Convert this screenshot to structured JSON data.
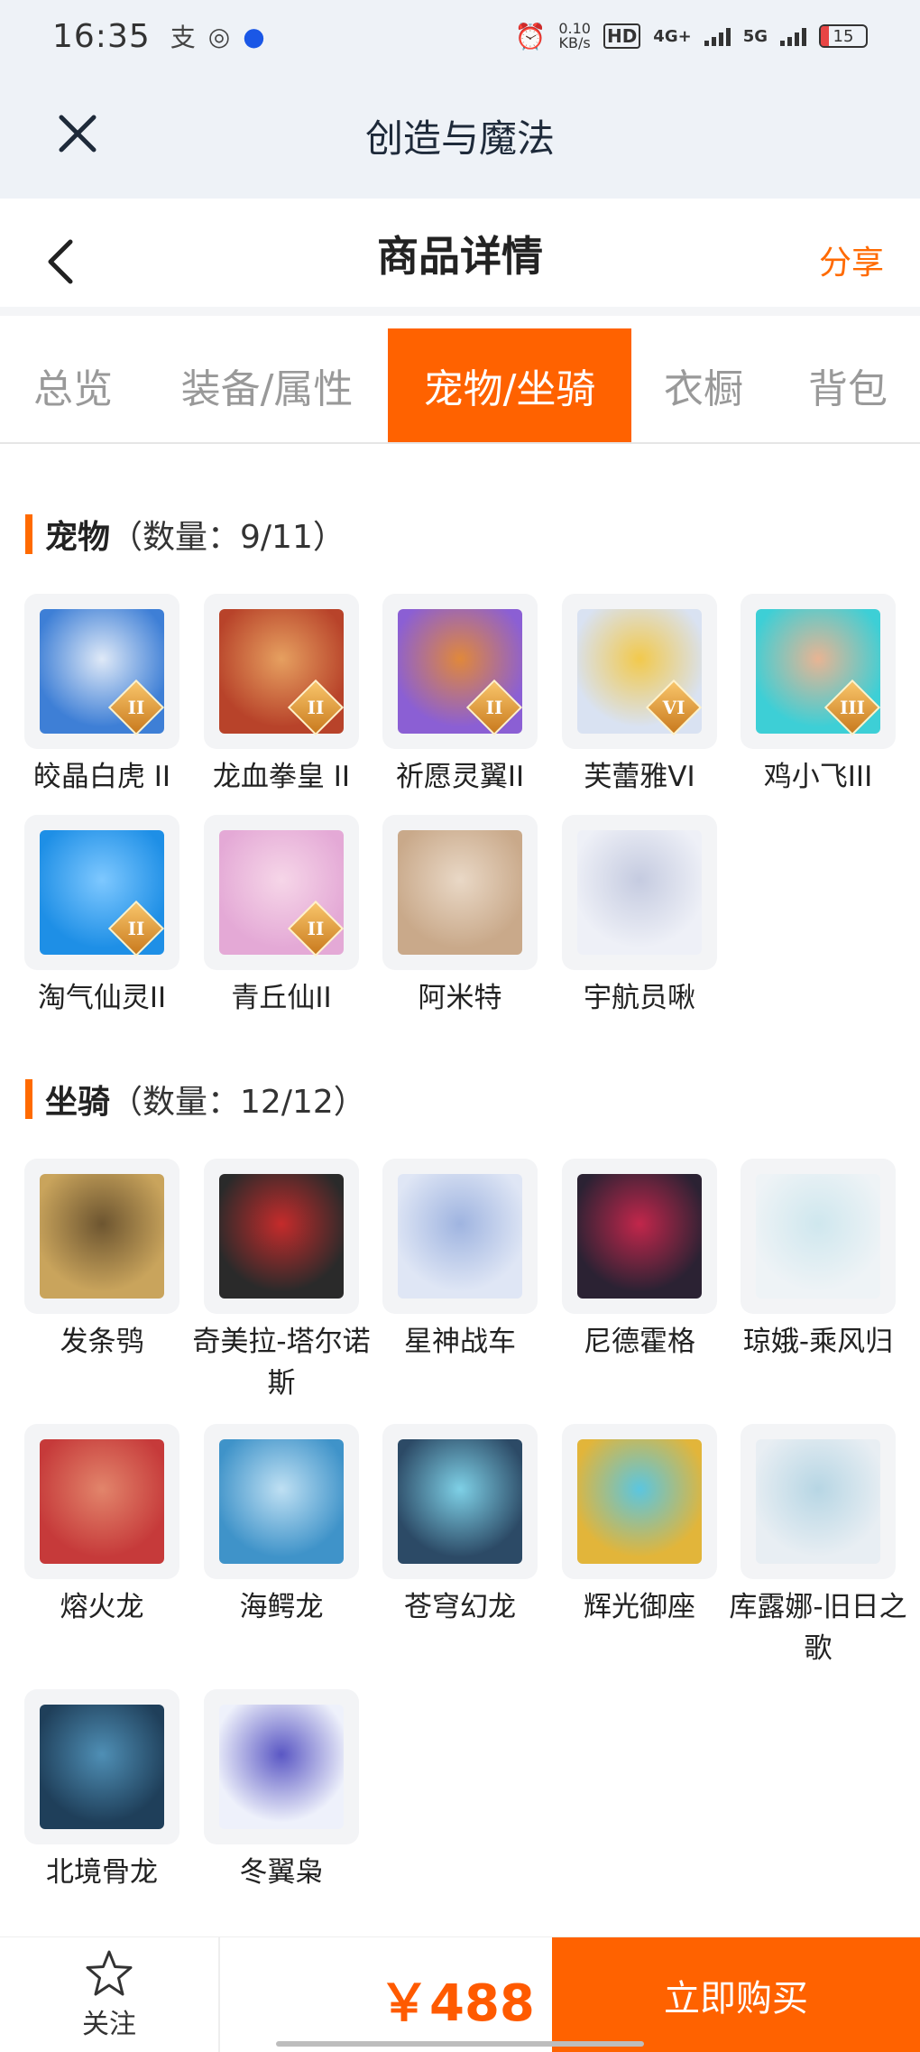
{
  "status_bar": {
    "time": "16:35",
    "net_speed": "0.10\nKB/s",
    "hd": "HD",
    "net1": "4G+",
    "net2": "5G",
    "battery": "15"
  },
  "web_header": {
    "title": "创造与魔法"
  },
  "nav": {
    "title": "商品详情",
    "share": "分享"
  },
  "tabs": [
    {
      "label": "总览",
      "active": false
    },
    {
      "label": "装备/属性",
      "active": false
    },
    {
      "label": "宠物/坐骑",
      "active": true
    },
    {
      "label": "衣橱",
      "active": false
    },
    {
      "label": "背包",
      "active": false
    }
  ],
  "pets": {
    "title": "宠物",
    "count": "（数量：9/11）",
    "items": [
      {
        "name": "皎晶白虎 II",
        "badge": "II",
        "colors": [
          "#3e7fd6",
          "#dfe9f7"
        ]
      },
      {
        "name": "龙血拳皇 II",
        "badge": "II",
        "colors": [
          "#b8432a",
          "#e6a060"
        ]
      },
      {
        "name": "祈愿灵翼II",
        "badge": "II",
        "colors": [
          "#8b5fd4",
          "#e0883b"
        ]
      },
      {
        "name": "芙蕾雅VI",
        "badge": "VI",
        "colors": [
          "#d9e2f2",
          "#f2c94c"
        ]
      },
      {
        "name": "鸡小飞III",
        "badge": "III",
        "colors": [
          "#3dcfd6",
          "#e8b493"
        ]
      },
      {
        "name": "淘气仙灵II",
        "badge": "II",
        "colors": [
          "#1e8fe6",
          "#7ec8ff"
        ]
      },
      {
        "name": "青丘仙II",
        "badge": "II",
        "colors": [
          "#e4a9d6",
          "#f6d6e8"
        ]
      },
      {
        "name": "阿米特",
        "badge": "",
        "colors": [
          "#c9a98a",
          "#e9d8c6"
        ]
      },
      {
        "name": "宇航员啾",
        "badge": "",
        "colors": [
          "#eef0f7",
          "#c5cbe0"
        ]
      }
    ]
  },
  "mounts": {
    "title": "坐骑",
    "count": "（数量：12/12）",
    "items": [
      {
        "name": "发条鸮",
        "colors": [
          "#c9a45c",
          "#6d5530"
        ]
      },
      {
        "name": "奇美拉-塔尔诺斯",
        "colors": [
          "#2a2a2a",
          "#c52b2b"
        ]
      },
      {
        "name": "星神战车",
        "colors": [
          "#dfe6f5",
          "#9fb4e0"
        ]
      },
      {
        "name": "尼德霍格",
        "colors": [
          "#2b2233",
          "#c2264b"
        ]
      },
      {
        "name": "琼娥-乘风归",
        "colors": [
          "#eef3f6",
          "#cfe7ee"
        ]
      },
      {
        "name": "熔火龙",
        "colors": [
          "#c63a3a",
          "#e2856b"
        ]
      },
      {
        "name": "海鳄龙",
        "colors": [
          "#3f93c9",
          "#bfe0f3"
        ]
      },
      {
        "name": "苍穹幻龙",
        "colors": [
          "#2c4a66",
          "#7ed0e6"
        ]
      },
      {
        "name": "辉光御座",
        "colors": [
          "#e2b53a",
          "#5bc6e0"
        ]
      },
      {
        "name": "库露娜-旧日之歌",
        "colors": [
          "#e8eef3",
          "#b7d6e4"
        ]
      },
      {
        "name": "北境骨龙",
        "colors": [
          "#1f3f5a",
          "#4f8fb5"
        ]
      },
      {
        "name": "冬翼枭",
        "colors": [
          "#eef1fb",
          "#5a57c4"
        ]
      }
    ]
  },
  "bottom": {
    "follow": "关注",
    "price": "￥488",
    "buy": "立即购买"
  }
}
